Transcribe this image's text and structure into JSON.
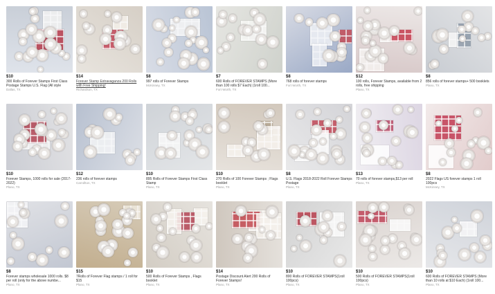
{
  "listings": [
    {
      "price": "$10",
      "title": "300 Rolls of Forever Stamps First Class Postage Stamps U.S. Flag (All style",
      "location": "Dallas, TX",
      "palette": [
        "#dfe3ea",
        "#c9cfd8",
        "#b5394a",
        "#f2f2f2"
      ],
      "linked": false
    },
    {
      "price": "$14",
      "title": "Forever Stamp Extravaganza 200 Rolls with Free Shipping!",
      "location": "Richardson, TX",
      "palette": [
        "#e8e4de",
        "#d6cfc6",
        "#c4485a",
        "#f4f0ea"
      ],
      "linked": true
    },
    {
      "price": "$8",
      "title": "997 rolls of Forever Stamps",
      "location": "McKinney, TX",
      "palette": [
        "#d9dde6",
        "#b9c4d5",
        "#3f5b8c",
        "#f5f5f5"
      ],
      "linked": false
    },
    {
      "price": "$7",
      "title": "600 Rolls of FOREVER STAMPS (More than 100 rolls $7 Each) (1roll 100...",
      "location": "Fort Worth, TX",
      "palette": [
        "#e6e6e2",
        "#cfd2cc",
        "#a8b0b5",
        "#f7f7f5"
      ],
      "linked": false
    },
    {
      "price": "$8",
      "title": "768 rolls of forever stamps",
      "location": "Fort Worth, TX",
      "palette": [
        "#d8dbe4",
        "#9aa9c6",
        "#c44c57",
        "#eef0f5"
      ],
      "linked": false
    },
    {
      "price": "$12",
      "title": "100 rolls, Forever Stamps, available from 2 rolls, free shipping",
      "location": "Plano, TX",
      "palette": [
        "#ece7e6",
        "#d8c9c9",
        "#c63d4f",
        "#f5f2f0"
      ],
      "linked": false
    },
    {
      "price": "$8",
      "title": "856 rolls of forever stamps+ 500 booklets",
      "location": "Plano, TX",
      "palette": [
        "#e3e4e6",
        "#c8ccd2",
        "#8e9aa8",
        "#f6f6f6"
      ],
      "linked": false
    },
    {
      "price": "$10",
      "title": "Forever Stamps, 1000 rolls for sale (2017-2022)",
      "location": "Plano, TX",
      "palette": [
        "#e2e2e4",
        "#cbcdd4",
        "#b24655",
        "#f3f3f3"
      ],
      "linked": false
    },
    {
      "price": "$12",
      "title": "236 rolls of forever stamps",
      "location": "Carrollton, TX",
      "palette": [
        "#dde0e6",
        "#b7c0d0",
        "#3e5e8e",
        "#f3f4f6"
      ],
      "linked": false
    },
    {
      "price": "$10",
      "title": "895 Rolls of Forever Stamps First Class Stamp",
      "location": "Plano, TX",
      "palette": [
        "#e4e6e8",
        "#cfd3d8",
        "#8c98a6",
        "#f8f8f8"
      ],
      "linked": false
    },
    {
      "price": "$10",
      "title": "270 Rolls of 100 Forever Stamps ; Flags booklet",
      "location": "Plano, TX",
      "palette": [
        "#e7e2dc",
        "#d2c8bc",
        "#b3a48f",
        "#f7f3ee"
      ],
      "linked": false
    },
    {
      "price": "$8",
      "title": "U.S. Flags 2018-2022 Roll Forever Stamps Postage",
      "location": "Plano, TX",
      "palette": [
        "#e9e9ea",
        "#d4d4d8",
        "#c14a58",
        "#fbfbfb"
      ],
      "linked": false
    },
    {
      "price": "$13",
      "title": "70 rolls of forever stamps,$13 per roll",
      "location": "Plano, TX",
      "palette": [
        "#f0eef2",
        "#ddd6e3",
        "#b94a66",
        "#ffffff"
      ],
      "linked": false
    },
    {
      "price": "$8",
      "title": "2022 Flags US forever stamps 1 roll 100pcs",
      "location": "McKinney, TX",
      "palette": [
        "#f2eaea",
        "#e2cccc",
        "#c23d54",
        "#ffffff"
      ],
      "linked": false
    },
    {
      "price": "$8",
      "title": "Forever stamps wholesale 1000 rolls. $8 per roll (only for the above numbe...",
      "location": "Plano, TX",
      "palette": [
        "#e1e2e6",
        "#c2c7d2",
        "#415f93",
        "#f5f5f7"
      ],
      "linked": false
    },
    {
      "price": "$15",
      "title": "7Rolls of Forever Flag stamps / 1 roll for $15",
      "location": "Plano, TX",
      "palette": [
        "#d6cbb8",
        "#c2ae8e",
        "#3b5b92",
        "#efe9de"
      ],
      "linked": false
    },
    {
      "price": "$10",
      "title": "500 Rolls of Forever Stamps , Flags booklet",
      "location": "Plano, TX",
      "palette": [
        "#e6e3de",
        "#d3cdc4",
        "#b54858",
        "#f7f4ef"
      ],
      "linked": false
    },
    {
      "price": "$14",
      "title": "Postage Discount Alert 200 Rolls of Forever Stamps!",
      "location": "Plano, TX",
      "palette": [
        "#e5e1dc",
        "#cfc7be",
        "#c44a52",
        "#f5f1ec"
      ],
      "linked": false
    },
    {
      "price": "$10",
      "title": "800 Rolls of FOREVER STAMPS(1roll 100pcs)",
      "location": "Plano, TX",
      "palette": [
        "#e8e8e8",
        "#d2d2d2",
        "#b8404e",
        "#fafafa"
      ],
      "linked": false
    },
    {
      "price": "$10",
      "title": "500 Rolls of FOREVER STAMPS(1roll 100pcs)",
      "location": "Plano, TX",
      "palette": [
        "#ece9e7",
        "#dad3cf",
        "#c0475a",
        "#fbfbfb"
      ],
      "linked": false
    },
    {
      "price": "$10",
      "title": "600 Rolls of FOREVER STAMPS (More than 10 rolls at $10 Each) (1roll 100...",
      "location": "Plano, TX",
      "palette": [
        "#e6e7ea",
        "#cfd3da",
        "#4c6a98",
        "#f7f7f8"
      ],
      "linked": false
    }
  ]
}
